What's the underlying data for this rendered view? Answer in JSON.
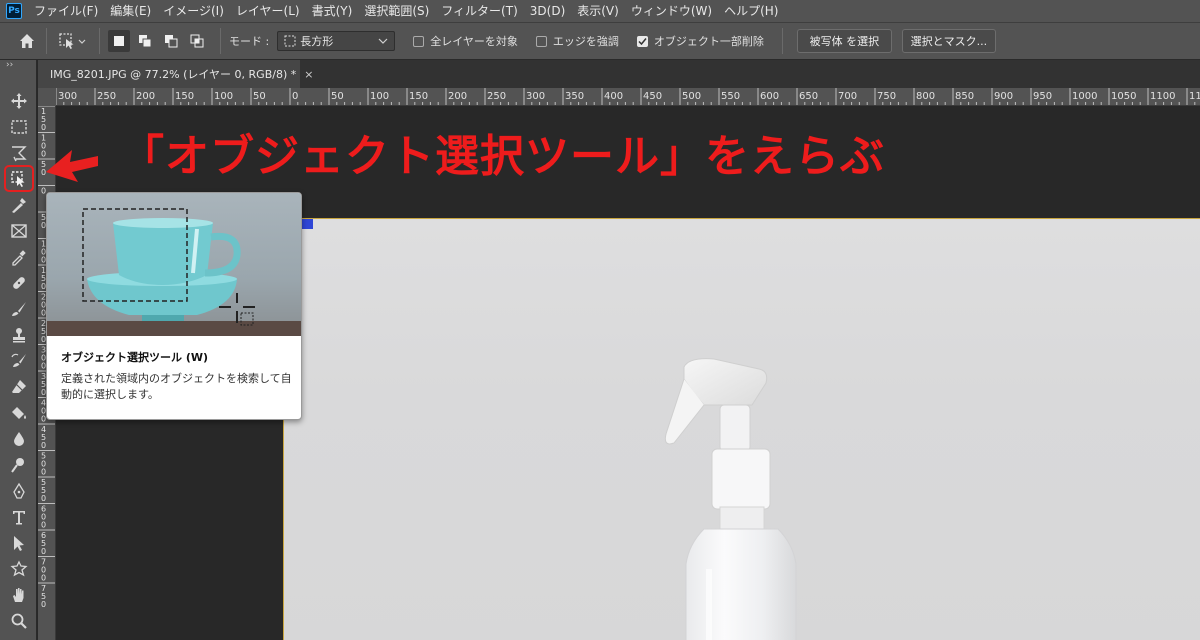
{
  "app": {
    "logo": "Ps",
    "menu": [
      "ファイル(F)",
      "編集(E)",
      "イメージ(I)",
      "レイヤー(L)",
      "書式(Y)",
      "選択範囲(S)",
      "フィルター(T)",
      "3D(D)",
      "表示(V)",
      "ウィンドウ(W)",
      "ヘルプ(H)"
    ]
  },
  "options": {
    "mode_label": "モード :",
    "mode_value": "長方形",
    "checkbox_all_layers": "全レイヤーを対象",
    "checkbox_enhance_edge": "エッジを強調",
    "checkbox_object_subtract": "オブジェクト一部削除",
    "checkbox_object_subtract_checked": true,
    "select_subject_button": "被写体 を選択",
    "select_and_mask_button": "選択とマスク..."
  },
  "tab": {
    "title": "IMG_8201.JPG @ 77.2% (レイヤー 0, RGB/8) *",
    "close": "×"
  },
  "ruler": {
    "top_labels": [
      "300",
      "250",
      "200",
      "150",
      "100",
      "50",
      "0",
      "50",
      "100",
      "150",
      "200",
      "250",
      "300",
      "350",
      "400",
      "450",
      "500",
      "550",
      "600",
      "650",
      "700",
      "750",
      "800",
      "850",
      "900",
      "950",
      "1000",
      "1050",
      "1100",
      "1150"
    ],
    "left_labels": [
      "1 5 0",
      "1 0 0",
      "5 0",
      "0",
      "5 0",
      "1 0 0",
      "1 5 0",
      "2 0 0",
      "2 5 0",
      "3 0 0",
      "3 5 0",
      "4 0 0",
      "4 5 0",
      "5 0 0",
      "5 5 0",
      "6 0 0",
      "6 5 0",
      "7 0 0",
      "7 5 0"
    ]
  },
  "annotation": {
    "text": "「オブジェクト選択ツール」をえらぶ",
    "color": "#ee1c1c"
  },
  "tooltip": {
    "title": "オブジェクト選択ツール (W)",
    "description": "定義された領域内のオブジェクトを検索して自動的に選択します。"
  },
  "tools": [
    "move-tool-icon",
    "marquee-tool-icon",
    "lasso-tool-icon",
    "object-selection-tool-icon",
    "quick-selection-tool-icon",
    "crop-tool-icon",
    "frame-tool-icon",
    "eyedropper-tool-icon",
    "healing-brush-tool-icon",
    "brush-tool-icon",
    "clone-stamp-tool-icon",
    "history-brush-tool-icon",
    "eraser-tool-icon",
    "paint-bucket-tool-icon",
    "blur-tool-icon",
    "dodge-tool-icon",
    "pen-tool-icon",
    "type-tool-icon",
    "path-selection-tool-icon",
    "custom-shape-tool-icon",
    "hand-tool-icon",
    "zoom-tool-icon"
  ]
}
